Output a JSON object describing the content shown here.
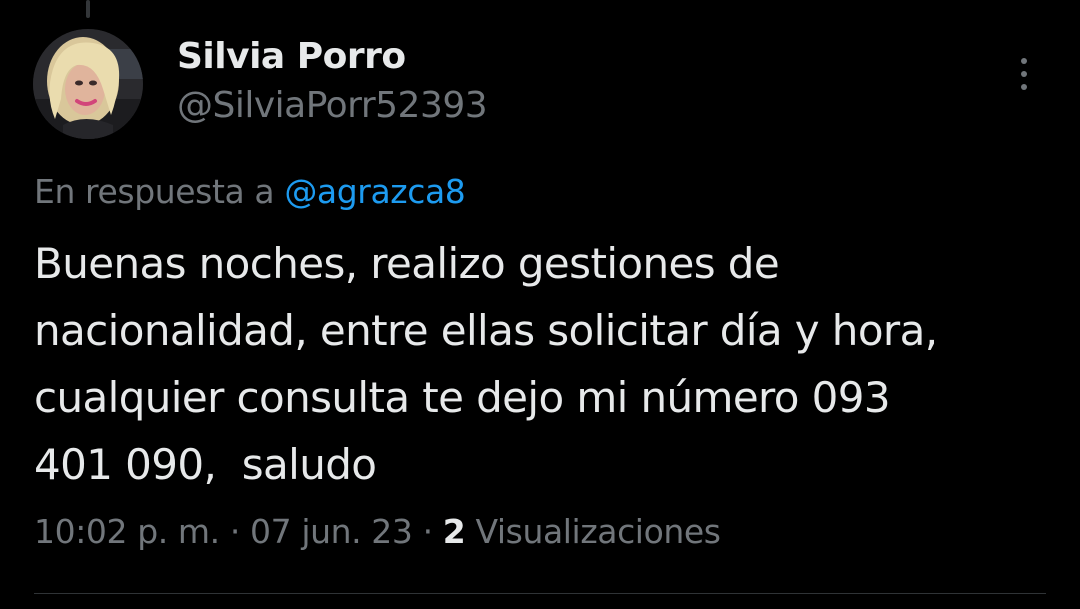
{
  "author": {
    "display_name": "Silvia Porro",
    "handle": "@SilviaPorr52393"
  },
  "reply": {
    "prefix": "En respuesta a",
    "mention": "@agrazca8"
  },
  "tweet": {
    "lines": [
      "Buenas noches, realizo gestiones de",
      "nacionalidad, entre ellas solicitar día y hora,",
      "cualquier consulta te dejo mi número 093",
      "401 090,  saludo"
    ]
  },
  "meta": {
    "time": "10:02 p. m.",
    "separator": "·",
    "date": "07 jun. 23",
    "views_count": "2",
    "views_label": "Visualizaciones"
  },
  "icons": {
    "more": "more-vertical-icon"
  },
  "colors": {
    "background": "#000000",
    "primary_text": "#e7e9ea",
    "secondary_text": "#71767b",
    "link": "#1d9bf0"
  }
}
